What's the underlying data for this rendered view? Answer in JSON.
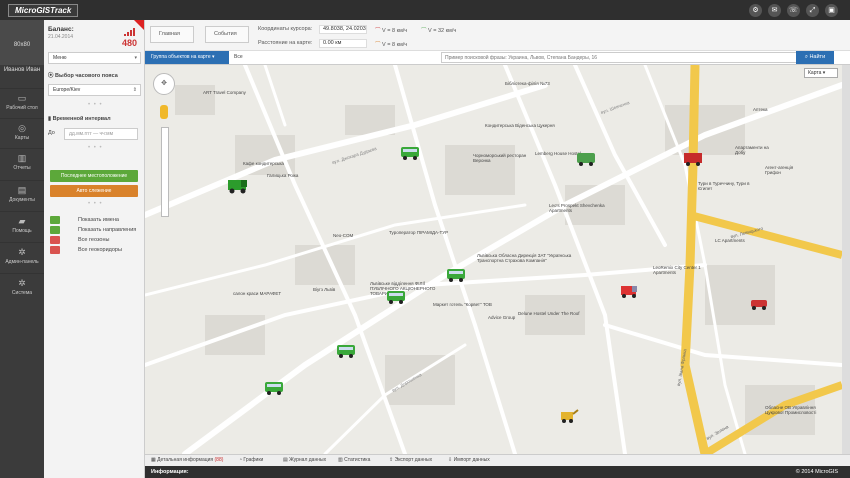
{
  "app": {
    "logo": "MicroGISTrack"
  },
  "topbar": {
    "icons": [
      "cog-icon",
      "mail-icon",
      "phone-icon",
      "fullscreen-icon",
      "lock-icon"
    ]
  },
  "user": {
    "avatar_text": "80x80",
    "name": "Иванов Иван"
  },
  "nav": [
    {
      "label": "Рабочий стол",
      "icon": "monitor-icon"
    },
    {
      "label": "Карты",
      "icon": "map-icon"
    },
    {
      "label": "Отчеты",
      "icon": "chart-icon"
    },
    {
      "label": "Документы",
      "icon": "document-icon"
    },
    {
      "label": "Помощь",
      "icon": "chat-icon"
    },
    {
      "label": "Админ-панель",
      "icon": "admin-gear-icon"
    },
    {
      "label": "Система",
      "icon": "system-gear-icon"
    }
  ],
  "panel": {
    "balance_label": "Баланс:",
    "balance_date": "21.04.2014",
    "balance_amount": "480",
    "menu_select": "Меню",
    "tz_title": "Выбор часового пояса",
    "tz_value": "Europe/Kiev",
    "interval_title": "Временной интервал",
    "from_label": "До",
    "date_placeholder": "дд.мм.гггг — чч:мм",
    "btn_last": "Последнее местоположение",
    "btn_auto": "Авто слежение",
    "checks": [
      {
        "label": "Показать имена",
        "state": "on"
      },
      {
        "label": "Показать направления",
        "state": "on"
      },
      {
        "label": "Все геозоны",
        "state": "off"
      },
      {
        "label": "Все геокоридоры",
        "state": "off"
      }
    ]
  },
  "toolbar": {
    "btn_main": "Главная",
    "btn_events": "События",
    "coords_label": "Координаты курсора:",
    "coords_value": "49.8038, 24.0203",
    "dist_label": "Расстояние на карте:",
    "dist_value": "0.00 км",
    "speed1": "V = 8 км/ч",
    "speed2": "V = 32 км/ч",
    "speed3": "V = 8 км/ч"
  },
  "search": {
    "group_btn": "Группа объектов на карте",
    "all_label": "Все",
    "placeholder": "Пример поисковой фразы: Украина, Львов, Степана Бандеры, 16",
    "find_btn": "Найти"
  },
  "map": {
    "type": "Карта",
    "labels": [
      {
        "t": "ART Travel Company"
      },
      {
        "t": "Кафе кондитерська"
      },
      {
        "t": "Галицька Рожа"
      },
      {
        "t": "Туроператор ПІРАМІДА-ТУР"
      },
      {
        "t": "Neo-COM"
      },
      {
        "t": "Віугз Львів"
      },
      {
        "t": "салон краси МАРАФЕТ"
      },
      {
        "t": "Маркет готель \"Корвет\" ТОВ"
      },
      {
        "t": "Львівське відділення ФІЛІЇ ПУБЛІЧНОГО АКЦІОНЕРНОГО ТОВАРИСТВА"
      },
      {
        "t": "Advice Group"
      },
      {
        "t": "Delune Hostel Under The Roof"
      },
      {
        "t": "Бібліотека-філія №73"
      },
      {
        "t": "Кондитерська Віденська Цукерня"
      },
      {
        "t": "Чорноморський ресторан Веронка"
      },
      {
        "t": "Lemberg House Hostel"
      },
      {
        "t": "Leo's Prospekt Shevchenka Apartments"
      },
      {
        "t": "Львівська Обласна Дирекція ЗАТ \"Українська Транспортна Страхова Компанія\""
      },
      {
        "t": "LeoRemix City Center 1 Apartments"
      },
      {
        "t": "LC Apartments"
      },
      {
        "t": "Апартаменти на Добу"
      },
      {
        "t": "Аптека"
      },
      {
        "t": "Тури в Туреччину, Тури в Єгипет"
      },
      {
        "t": "Агент-агенція Грифон"
      },
      {
        "t": "Обласне ОВ Управління Цукрової Промисловості"
      },
      {
        "t": "вул. Джохара Дудаєва"
      },
      {
        "t": "вул. Івана Франка"
      },
      {
        "t": "вул. Зелена"
      },
      {
        "t": "вул. Левицького"
      },
      {
        "t": "вул. Шевченка"
      },
      {
        "t": "вул. Дорошенка"
      }
    ]
  },
  "bottom": {
    "tabs": [
      {
        "label": "Детальная информация",
        "count": "(88)"
      },
      {
        "label": "Графики",
        "count": ""
      },
      {
        "label": "Журнал данных",
        "count": ""
      },
      {
        "label": "Статистика",
        "count": ""
      },
      {
        "label": "Экспорт данных",
        "count": ""
      },
      {
        "label": "Импорт данных",
        "count": ""
      }
    ],
    "info_label": "Информация:",
    "copyright": "© 2014 MicroGIS"
  }
}
